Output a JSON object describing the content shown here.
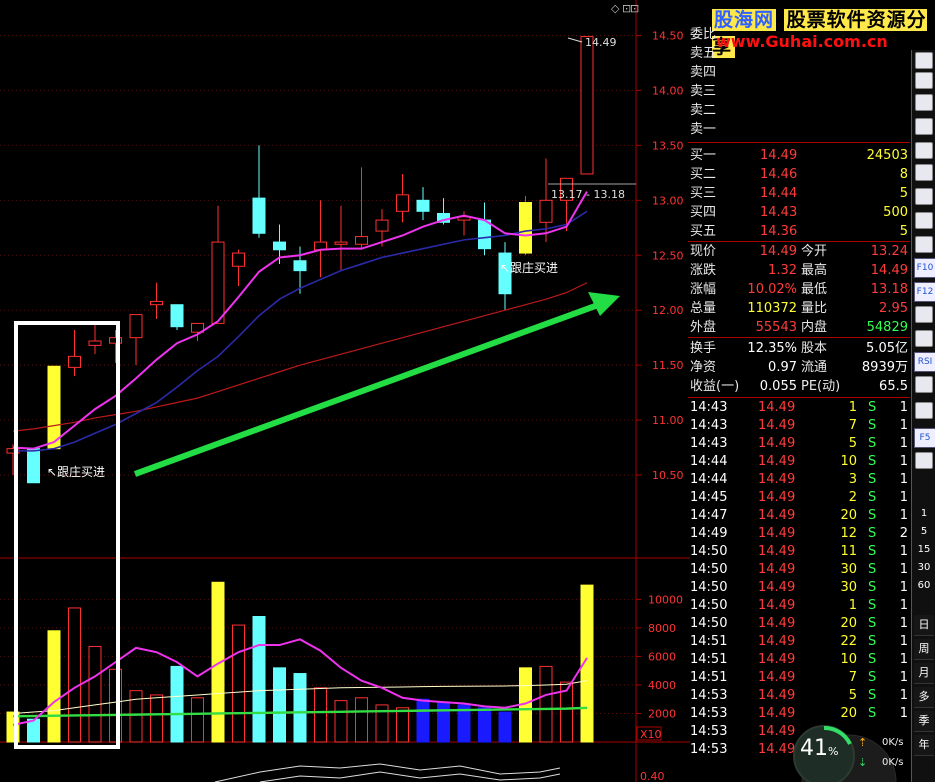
{
  "watermark": {
    "brand": "股海网",
    "tagline": "股票软件资源分享",
    "url": "www.Guhai.com.cn"
  },
  "chart_data": {
    "type": "candlestick",
    "price_axis": {
      "ticks": [
        "14.50",
        "14.00",
        "13.50",
        "13.00",
        "12.50",
        "12.00",
        "11.50",
        "11.00",
        "10.50"
      ],
      "min": 10.0,
      "max": 14.75
    },
    "volume_axis": {
      "ticks": [
        "10000",
        "8000",
        "6000",
        "4000",
        "2000"
      ],
      "max": 11500,
      "unit_label": "X10"
    },
    "candles": [
      {
        "o": 10.7,
        "h": 10.78,
        "l": 10.5,
        "c": 10.74,
        "col": "red"
      },
      {
        "o": 10.74,
        "h": 10.74,
        "l": 10.43,
        "c": 10.43,
        "col": "cyan"
      },
      {
        "o": 10.74,
        "h": 11.49,
        "l": 10.74,
        "c": 11.49,
        "col": "yellow"
      },
      {
        "o": 11.48,
        "h": 11.82,
        "l": 11.4,
        "c": 11.58,
        "col": "red"
      },
      {
        "o": 11.68,
        "h": 11.88,
        "l": 11.6,
        "c": 11.72,
        "col": "red"
      },
      {
        "o": 11.7,
        "h": 11.82,
        "l": 11.52,
        "c": 11.75,
        "col": "red"
      },
      {
        "o": 11.75,
        "h": 11.96,
        "l": 11.5,
        "c": 11.96,
        "col": "red"
      },
      {
        "o": 12.05,
        "h": 12.25,
        "l": 11.92,
        "c": 12.08,
        "col": "red"
      },
      {
        "o": 12.05,
        "h": 12.05,
        "l": 11.82,
        "c": 11.85,
        "col": "cyan"
      },
      {
        "o": 11.8,
        "h": 11.88,
        "l": 11.72,
        "c": 11.88,
        "col": "red"
      },
      {
        "o": 11.88,
        "h": 12.95,
        "l": 11.88,
        "c": 12.62,
        "col": "red"
      },
      {
        "o": 12.4,
        "h": 12.55,
        "l": 12.22,
        "c": 12.52,
        "col": "red"
      },
      {
        "o": 13.02,
        "h": 13.5,
        "l": 12.66,
        "c": 12.7,
        "col": "cyan"
      },
      {
        "o": 12.62,
        "h": 12.78,
        "l": 12.42,
        "c": 12.55,
        "col": "cyan"
      },
      {
        "o": 12.45,
        "h": 12.58,
        "l": 12.15,
        "c": 12.36,
        "col": "cyan"
      },
      {
        "o": 12.55,
        "h": 13.0,
        "l": 12.3,
        "c": 12.62,
        "col": "red"
      },
      {
        "o": 12.6,
        "h": 12.95,
        "l": 12.36,
        "c": 12.62,
        "col": "red"
      },
      {
        "o": 12.6,
        "h": 13.3,
        "l": 12.55,
        "c": 12.67,
        "col": "red"
      },
      {
        "o": 12.72,
        "h": 12.92,
        "l": 12.58,
        "c": 12.82,
        "col": "red"
      },
      {
        "o": 12.9,
        "h": 13.24,
        "l": 12.8,
        "c": 13.05,
        "col": "red"
      },
      {
        "o": 13.0,
        "h": 13.12,
        "l": 12.82,
        "c": 12.9,
        "col": "cyan"
      },
      {
        "o": 12.88,
        "h": 13.02,
        "l": 12.78,
        "c": 12.8,
        "col": "cyan"
      },
      {
        "o": 12.82,
        "h": 12.9,
        "l": 12.68,
        "c": 12.85,
        "col": "red"
      },
      {
        "o": 12.82,
        "h": 12.98,
        "l": 12.5,
        "c": 12.56,
        "col": "cyan"
      },
      {
        "o": 12.52,
        "h": 12.62,
        "l": 12.0,
        "c": 12.15,
        "col": "cyan"
      },
      {
        "o": 12.52,
        "h": 13.04,
        "l": 12.5,
        "c": 12.98,
        "col": "yellow"
      },
      {
        "o": 12.8,
        "h": 13.38,
        "l": 12.62,
        "c": 13.0,
        "col": "red"
      },
      {
        "o": 13.0,
        "h": 13.2,
        "l": 12.72,
        "c": 13.2,
        "col": "red"
      },
      {
        "o": 13.24,
        "h": 14.49,
        "l": 13.24,
        "c": 14.49,
        "col": "red"
      }
    ],
    "volumes": [
      {
        "v": 2100,
        "col": "yellow"
      },
      {
        "v": 1600,
        "col": "cyan"
      },
      {
        "v": 7800,
        "col": "yellow"
      },
      {
        "v": 9400,
        "col": "red"
      },
      {
        "v": 6700,
        "col": "red"
      },
      {
        "v": 5100,
        "col": "red"
      },
      {
        "v": 3600,
        "col": "red"
      },
      {
        "v": 3300,
        "col": "red"
      },
      {
        "v": 5300,
        "col": "cyan"
      },
      {
        "v": 3100,
        "col": "red"
      },
      {
        "v": 11200,
        "col": "yellow"
      },
      {
        "v": 8200,
        "col": "red"
      },
      {
        "v": 8800,
        "col": "cyan"
      },
      {
        "v": 5200,
        "col": "cyan"
      },
      {
        "v": 4800,
        "col": "cyan"
      },
      {
        "v": 3800,
        "col": "red"
      },
      {
        "v": 2900,
        "col": "red"
      },
      {
        "v": 3100,
        "col": "red"
      },
      {
        "v": 2600,
        "col": "red"
      },
      {
        "v": 2400,
        "col": "red"
      },
      {
        "v": 3000,
        "col": "blue"
      },
      {
        "v": 2800,
        "col": "blue"
      },
      {
        "v": 2600,
        "col": "blue"
      },
      {
        "v": 2400,
        "col": "blue"
      },
      {
        "v": 2100,
        "col": "blue"
      },
      {
        "v": 5200,
        "col": "yellow"
      },
      {
        "v": 5300,
        "col": "red"
      },
      {
        "v": 4200,
        "col": "red"
      },
      {
        "v": 11000,
        "col": "yellow"
      }
    ],
    "ma5": [
      10.75,
      10.74,
      10.8,
      10.95,
      11.1,
      11.22,
      11.38,
      11.55,
      11.7,
      11.78,
      11.9,
      12.12,
      12.35,
      12.48,
      12.5,
      12.55,
      12.56,
      12.56,
      12.62,
      12.68,
      12.76,
      12.82,
      12.86,
      12.82,
      12.7,
      12.68,
      12.7,
      12.76,
      13.08
    ],
    "ma10": [
      10.72,
      10.72,
      10.74,
      10.8,
      10.88,
      10.96,
      11.06,
      11.16,
      11.3,
      11.45,
      11.58,
      11.76,
      11.95,
      12.1,
      12.2,
      12.28,
      12.36,
      12.42,
      12.48,
      12.52,
      12.56,
      12.6,
      12.64,
      12.66,
      12.68,
      12.72,
      12.74,
      12.78,
      12.9
    ],
    "ma_long": [
      10.9,
      10.92,
      10.95,
      10.98,
      11.02,
      11.05,
      11.08,
      11.12,
      11.16,
      11.2,
      11.26,
      11.32,
      11.38,
      11.44,
      11.5,
      11.55,
      11.6,
      11.65,
      11.7,
      11.75,
      11.8,
      11.85,
      11.9,
      11.95,
      12.0,
      12.05,
      12.1,
      12.16,
      12.25
    ],
    "vol_ma5": [
      1200,
      1500,
      2800,
      3800,
      4600,
      5600,
      6600,
      6300,
      5600,
      4600,
      5500,
      6300,
      6800,
      6800,
      7200,
      6400,
      5200,
      4300,
      3800,
      3100,
      2900,
      2800,
      2700,
      2500,
      2400,
      2700,
      3300,
      3600,
      5900
    ],
    "vol_ma10": [
      2000,
      2100,
      2200,
      2400,
      2600,
      2800,
      3000,
      3100,
      3200,
      3300,
      3400,
      3500,
      3600,
      3650,
      3700,
      3750,
      3800,
      3820,
      3840,
      3860,
      3880,
      3900,
      3910,
      3920,
      3930,
      3950,
      4000,
      4050,
      4300
    ],
    "vol_ma60": [
      1800,
      1820,
      1840,
      1860,
      1880,
      1900,
      1920,
      1940,
      1960,
      1980,
      2000,
      2020,
      2040,
      2060,
      2080,
      2100,
      2120,
      2140,
      2160,
      2180,
      2200,
      2220,
      2240,
      2260,
      2280,
      2300,
      2320,
      2340,
      2400
    ],
    "high_label": "14.49",
    "range_label": "13.17 - 13.18",
    "annotation": "↖跟庄买进"
  },
  "quote": {
    "ask_labels": [
      "委比",
      "卖五",
      "卖四",
      "卖三",
      "卖二",
      "卖一"
    ],
    "bids": [
      {
        "label": "买一",
        "price": "14.49",
        "vol": "24503"
      },
      {
        "label": "买二",
        "price": "14.46",
        "vol": "8"
      },
      {
        "label": "买三",
        "price": "14.44",
        "vol": "5"
      },
      {
        "label": "买四",
        "price": "14.43",
        "vol": "500"
      },
      {
        "label": "买五",
        "price": "14.36",
        "vol": "5"
      }
    ],
    "stats": [
      {
        "l1": "现价",
        "v1": "14.49",
        "l2": "今开",
        "v2": "13.24"
      },
      {
        "l1": "涨跌",
        "v1": "1.32",
        "l2": "最高",
        "v2": "14.49"
      },
      {
        "l1": "涨幅",
        "v1": "10.02%",
        "l2": "最低",
        "v2": "13.18"
      },
      {
        "l1": "总量",
        "v1": "110372",
        "l2": "量比",
        "v2": "2.95"
      },
      {
        "l1": "外盘",
        "v1": "55543",
        "l2": "内盘",
        "v2": "54829"
      }
    ],
    "fund": [
      {
        "l1": "换手",
        "v1": "12.35%",
        "l2": "股本",
        "v2": "5.05亿"
      },
      {
        "l1": "净资",
        "v1": "0.97",
        "l2": "流通",
        "v2": "8939万"
      },
      {
        "l1": "收益(一)",
        "v1": "0.055",
        "l2": "PE(动)",
        "v2": "65.5"
      }
    ],
    "ticks": [
      {
        "t": "14:43",
        "p": "14.49",
        "v": "1",
        "s": "S",
        "n": "1"
      },
      {
        "t": "14:43",
        "p": "14.49",
        "v": "7",
        "s": "S",
        "n": "1"
      },
      {
        "t": "14:43",
        "p": "14.49",
        "v": "5",
        "s": "S",
        "n": "1"
      },
      {
        "t": "14:44",
        "p": "14.49",
        "v": "10",
        "s": "S",
        "n": "1"
      },
      {
        "t": "14:44",
        "p": "14.49",
        "v": "3",
        "s": "S",
        "n": "1"
      },
      {
        "t": "14:45",
        "p": "14.49",
        "v": "2",
        "s": "S",
        "n": "1"
      },
      {
        "t": "14:47",
        "p": "14.49",
        "v": "20",
        "s": "S",
        "n": "1"
      },
      {
        "t": "14:49",
        "p": "14.49",
        "v": "12",
        "s": "S",
        "n": "2"
      },
      {
        "t": "14:50",
        "p": "14.49",
        "v": "11",
        "s": "S",
        "n": "1"
      },
      {
        "t": "14:50",
        "p": "14.49",
        "v": "30",
        "s": "S",
        "n": "1"
      },
      {
        "t": "14:50",
        "p": "14.49",
        "v": "30",
        "s": "S",
        "n": "1"
      },
      {
        "t": "14:50",
        "p": "14.49",
        "v": "1",
        "s": "S",
        "n": "1"
      },
      {
        "t": "14:50",
        "p": "14.49",
        "v": "20",
        "s": "S",
        "n": "1"
      },
      {
        "t": "14:51",
        "p": "14.49",
        "v": "22",
        "s": "S",
        "n": "1"
      },
      {
        "t": "14:51",
        "p": "14.49",
        "v": "10",
        "s": "S",
        "n": "1"
      },
      {
        "t": "14:51",
        "p": "14.49",
        "v": "7",
        "s": "S",
        "n": "1"
      },
      {
        "t": "14:53",
        "p": "14.49",
        "v": "5",
        "s": "S",
        "n": "1"
      },
      {
        "t": "14:53",
        "p": "14.49",
        "v": "20",
        "s": "S",
        "n": "1"
      },
      {
        "t": "14:53",
        "p": "14.49",
        "v": "",
        "s": "",
        "n": ""
      },
      {
        "t": "14:53",
        "p": "14.49",
        "v": "",
        "s": "",
        "n": ""
      }
    ]
  },
  "speed_widget": {
    "percent": "41",
    "percent_unit": "%",
    "up": "0K/s",
    "down": "0K/s"
  },
  "toolbar": {
    "cn_items": [
      "日",
      "周",
      "月",
      "多",
      "季",
      "年"
    ],
    "num_items": [
      "1",
      "5",
      "15",
      "30",
      "60"
    ],
    "icons": [
      "list-icon",
      "diamond-icon",
      "arrow-icon",
      "bar-chart-icon",
      "line-chart-icon",
      "candle-icon",
      "fin-icon",
      "kline-icon",
      "grid-icon",
      "f10-icon",
      "f12-icon",
      "settings-icon",
      "wave-icon",
      "rsi-icon",
      "move-icon",
      "draw-icon",
      "f5-icon",
      "refresh-icon"
    ],
    "rsi_label": "RSI",
    "f10_label": "F10",
    "f12_label": "F12",
    "f5_label": "F5"
  },
  "top_icons": [
    "◇",
    "⊡",
    "⊡"
  ]
}
